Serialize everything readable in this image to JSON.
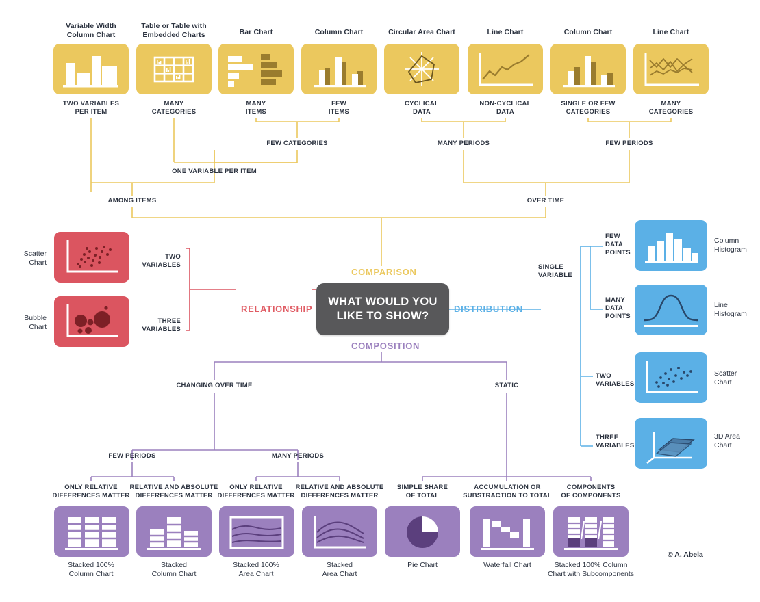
{
  "colors": {
    "comparison": "#EBC85E",
    "relationship": "#DB5560",
    "distribution": "#5BB0E6",
    "composition": "#9B80BE",
    "hub": "#58585A",
    "text": "#2c3340",
    "white": "#ffffff"
  },
  "hub": {
    "line1": "WHAT WOULD YOU",
    "line2": "LIKE TO SHOW?"
  },
  "branches": {
    "comparison": "COMPARISON",
    "relationship": "RELATIONSHIP",
    "distribution": "DISTRIBUTION",
    "composition": "COMPOSITION"
  },
  "credit": "© A. Abela",
  "comparison": {
    "root_left": "AMONG ITEMS",
    "root_right": "OVER TIME",
    "mid_left": "ONE VARIABLE PER ITEM",
    "mid_few_categories": "FEW CATEGORIES",
    "mid_many_periods": "MANY PERIODS",
    "mid_few_periods": "FEW PERIODS",
    "items": [
      {
        "title_line1": "Variable Width",
        "title_line2": "Column Chart",
        "cond_line1": "TWO VARIABLES",
        "cond_line2": "PER ITEM"
      },
      {
        "title_line1": "Table or Table with",
        "title_line2": "Embedded Charts",
        "cond_line1": "MANY",
        "cond_line2": "CATEGORIES"
      },
      {
        "title_line1": "Bar Chart",
        "title_line2": "",
        "cond_line1": "MANY",
        "cond_line2": "ITEMS"
      },
      {
        "title_line1": "Column Chart",
        "title_line2": "",
        "cond_line1": "FEW",
        "cond_line2": "ITEMS"
      },
      {
        "title_line1": "Circular Area Chart",
        "title_line2": "",
        "cond_line1": "CYCLICAL",
        "cond_line2": "DATA"
      },
      {
        "title_line1": "Line Chart",
        "title_line2": "",
        "cond_line1": "NON-CYCLICAL",
        "cond_line2": "DATA"
      },
      {
        "title_line1": "Column Chart",
        "title_line2": "",
        "cond_line1": "SINGLE OR FEW",
        "cond_line2": "CATEGORIES"
      },
      {
        "title_line1": "Line Chart",
        "title_line2": "",
        "cond_line1": "MANY",
        "cond_line2": "CATEGORIES"
      }
    ]
  },
  "relationship": {
    "items": [
      {
        "name_line1": "Scatter",
        "name_line2": "Chart",
        "cond_line1": "TWO",
        "cond_line2": "VARIABLES"
      },
      {
        "name_line1": "Bubble",
        "name_line2": "Chart",
        "cond_line1": "THREE",
        "cond_line2": "VARIABLES"
      }
    ]
  },
  "distribution": {
    "group_label_line1": "SINGLE",
    "group_label_line2": "VARIABLE",
    "items": [
      {
        "cond_line1": "FEW",
        "cond_line2": "DATA",
        "cond_line3": "POINTS",
        "name_line1": "Column",
        "name_line2": "Histogram"
      },
      {
        "cond_line1": "MANY",
        "cond_line2": "DATA",
        "cond_line3": "POINTS",
        "name_line1": "Line",
        "name_line2": "Histogram"
      },
      {
        "cond_line1": "TWO",
        "cond_line2": "VARIABLES",
        "cond_line3": "",
        "name_line1": "Scatter",
        "name_line2": "Chart"
      },
      {
        "cond_line1": "THREE",
        "cond_line2": "VARIABLES",
        "cond_line3": "",
        "name_line1": "3D Area",
        "name_line2": "Chart"
      }
    ]
  },
  "composition": {
    "changing_over_time": "CHANGING OVER TIME",
    "static": "STATIC",
    "few_periods": "FEW PERIODS",
    "many_periods": "MANY PERIODS",
    "items": [
      {
        "cond_line1": "ONLY RELATIVE",
        "cond_line2": "DIFFERENCES MATTER",
        "name_line1": "Stacked 100%",
        "name_line2": "Column Chart"
      },
      {
        "cond_line1": "RELATIVE AND ABSOLUTE",
        "cond_line2": "DIFFERENCES MATTER",
        "name_line1": "Stacked",
        "name_line2": "Column Chart"
      },
      {
        "cond_line1": "ONLY RELATIVE",
        "cond_line2": "DIFFERENCES MATTER",
        "name_line1": "Stacked 100%",
        "name_line2": "Area Chart"
      },
      {
        "cond_line1": "RELATIVE AND ABSOLUTE",
        "cond_line2": "DIFFERENCES MATTER",
        "name_line1": "Stacked",
        "name_line2": "Area Chart"
      },
      {
        "cond_line1": "SIMPLE SHARE",
        "cond_line2": "OF TOTAL",
        "name_line1": "Pie Chart",
        "name_line2": ""
      },
      {
        "cond_line1": "ACCUMULATION OR",
        "cond_line2": "SUBSTRACTION TO TOTAL",
        "name_line1": "Waterfall Chart",
        "name_line2": ""
      },
      {
        "cond_line1": "COMPONENTS",
        "cond_line2": "OF COMPONENTS",
        "name_line1": "Stacked 100% Column",
        "name_line2": "Chart with Subcomponents"
      }
    ]
  }
}
